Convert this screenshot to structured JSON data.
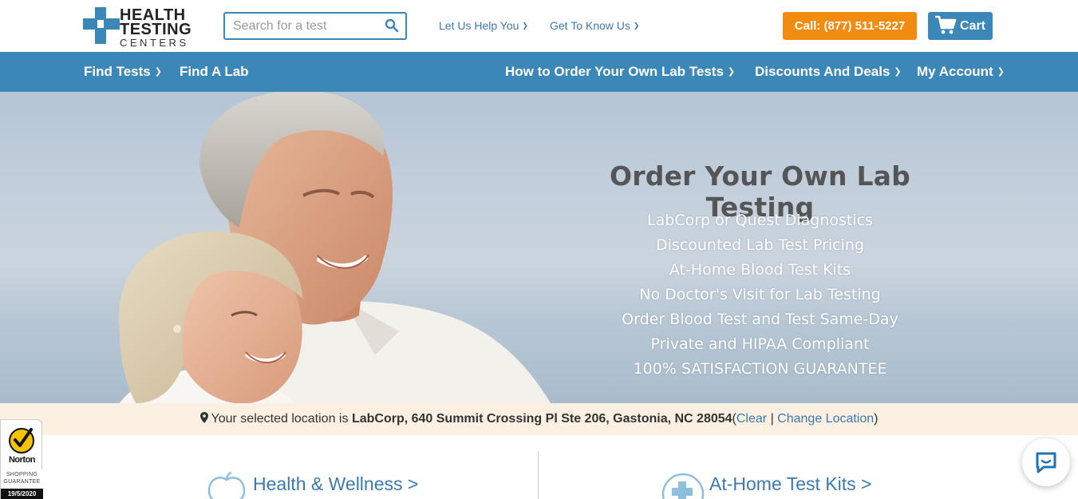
{
  "header": {
    "logo_lines": [
      "HEALTH",
      "TESTING",
      "CENTERS"
    ],
    "search": {
      "placeholder": "Search for a test",
      "value": ""
    },
    "links": [
      {
        "label": "Let Us Help You"
      },
      {
        "label": "Get To Know Us"
      }
    ],
    "call_label": "Call: (877) 511-5227",
    "cart_label": "Cart",
    "colors": {
      "brand_blue": "#3a87b8",
      "call_orange": "#f28c10",
      "link_blue": "#3a7ab0"
    }
  },
  "nav": {
    "left": [
      {
        "label": "Find Tests",
        "has_dropdown": true
      },
      {
        "label": "Find A Lab",
        "has_dropdown": false
      }
    ],
    "right": [
      {
        "label": "How to Order Your Own Lab Tests",
        "has_dropdown": true
      },
      {
        "label": "Discounts And Deals",
        "has_dropdown": true
      },
      {
        "label": "My Account",
        "has_dropdown": true
      }
    ]
  },
  "hero": {
    "title": "Order Your Own Lab Testing",
    "items": [
      "LabCorp or Quest Diagnostics",
      "Discounted Lab Test Pricing",
      "At-Home Blood Test Kits",
      "No Doctor's Visit for Lab Testing",
      "Order Blood Test and Test Same-Day",
      "Private and HIPAA Compliant",
      "100% SATISFACTION GUARANTEE"
    ]
  },
  "location": {
    "prefix": "Your selected location is",
    "name": "LabCorp, 640 Summit Crossing Pl Ste 206, Gastonia, NC 28054",
    "open_paren": "(",
    "clear_label": "Clear",
    "separator": "|",
    "change_label": "Change Location",
    "close_paren": ")"
  },
  "categories": [
    {
      "label": "Health & Wellness >",
      "icon": "apple-icon"
    },
    {
      "label": "At-Home Test Kits >",
      "icon": "test-kit-icon"
    }
  ],
  "norton": {
    "brand": "Norton",
    "guarantee_lines": [
      "SHOPPING",
      "GUARANTEE"
    ],
    "date": "19/5/2020"
  }
}
